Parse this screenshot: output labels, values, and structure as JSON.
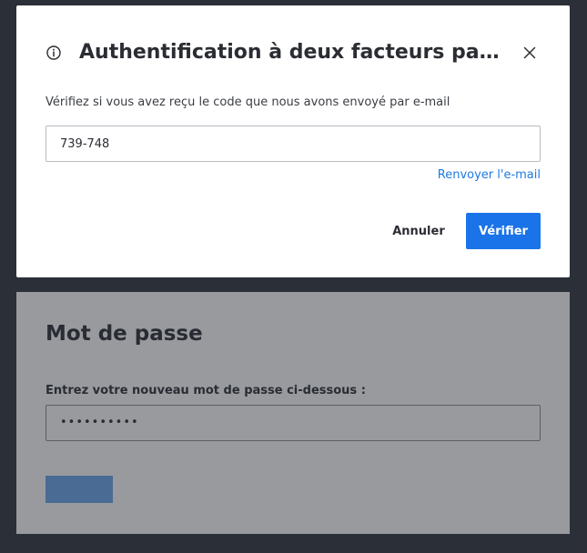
{
  "background_page": {
    "title": "Mot de passe",
    "password_label": "Entrez votre nouveau mot de passe ci-dessous :",
    "password_value": "••••••••••"
  },
  "dialog": {
    "icon": "info-icon",
    "title": "Authentification à deux facteurs par e...",
    "description": "Vérifiez si vous avez reçu le code que nous avons envoyé par e-mail",
    "code_value": "739-748",
    "resend_label": "Renvoyer l'e-mail",
    "cancel_label": "Annuler",
    "verify_label": "Vérifier"
  },
  "colors": {
    "primary": "#1a73e8",
    "link": "#1f7ae0",
    "backdrop": "#2f323a"
  }
}
